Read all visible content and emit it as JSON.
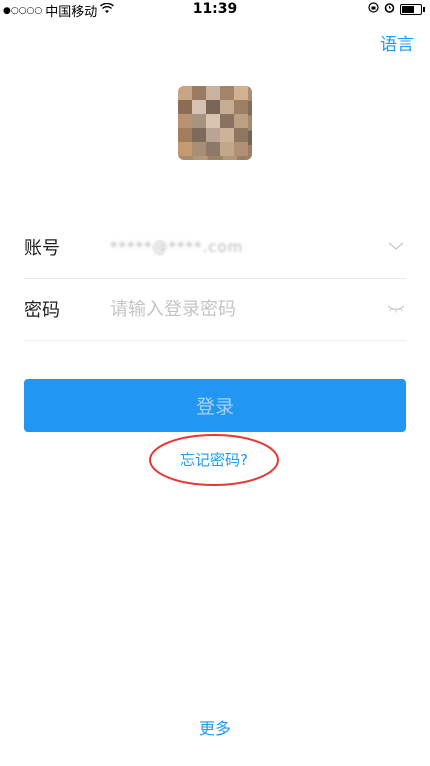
{
  "status_bar": {
    "signal_dots": "●○○○○",
    "carrier": "中国移动",
    "wifi_icon": "wifi-icon",
    "time": "11:39",
    "right_icons": [
      "orientation-lock-icon",
      "alarm-icon",
      "battery-icon"
    ]
  },
  "header": {
    "language_label": "语言"
  },
  "avatar": {
    "icon": "user-avatar"
  },
  "form": {
    "account_label": "账号",
    "account_value": "*****@****.com",
    "password_label": "密码",
    "password_placeholder": "请输入登录密码",
    "account_dropdown_icon": "chevron-down-icon",
    "password_toggle_icon": "eye-closed-icon"
  },
  "actions": {
    "login_label": "登录",
    "forgot_password_label": "忘记密码?",
    "more_label": "更多"
  },
  "colors": {
    "accent": "#1e9bf0",
    "button_bg": "#2196f3",
    "button_text": "#a7d3fb",
    "highlight_circle": "#e53935"
  }
}
